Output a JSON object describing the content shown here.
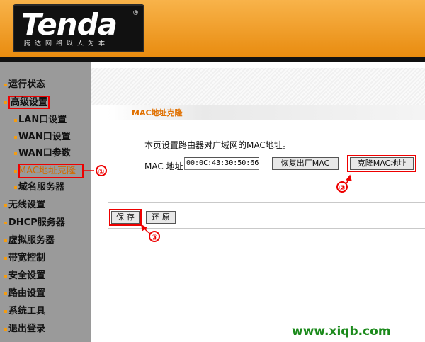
{
  "brand": {
    "name": "Tenda",
    "reg": "®",
    "tagline": "腾达网络以人为本"
  },
  "sidebar": {
    "items": [
      {
        "label": "运行状态"
      },
      {
        "label": "高级设置"
      },
      {
        "label": "LAN口设置"
      },
      {
        "label": "WAN口设置"
      },
      {
        "label": "WAN口参数"
      },
      {
        "label": "MAC地址克隆"
      },
      {
        "label": "域名服务器"
      },
      {
        "label": "无线设置"
      },
      {
        "label": "DHCP服务器"
      },
      {
        "label": "虚拟服务器"
      },
      {
        "label": "带宽控制"
      },
      {
        "label": "安全设置"
      },
      {
        "label": "路由设置"
      },
      {
        "label": "系统工具"
      },
      {
        "label": "退出登录"
      }
    ]
  },
  "main": {
    "title": "MAC地址克隆",
    "description": "本页设置路由器对广域网的MAC地址。",
    "mac_label": "MAC 地址",
    "mac_value": "00:0C:43:30:50:66",
    "restore_label": "恢复出厂MAC",
    "clone_label": "克隆MAC地址",
    "save_label": "保 存",
    "reset_label": "还 原"
  },
  "annotations": {
    "marker1": "①",
    "marker2": "②",
    "marker3": "③"
  },
  "watermark": "www.xiqb.com",
  "colors": {
    "accent": "#e98c10",
    "highlight": "#e00000",
    "watermark": "#1c8a1c"
  }
}
